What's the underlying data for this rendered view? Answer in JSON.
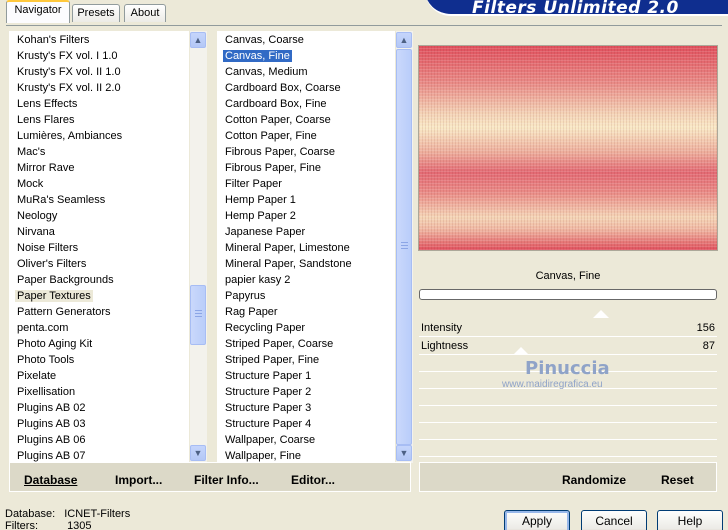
{
  "app": {
    "title": "Filters Unlimited 2.0"
  },
  "tabs": [
    {
      "label": "Navigator",
      "active": true
    },
    {
      "label": "Presets",
      "active": false
    },
    {
      "label": "About",
      "active": false
    }
  ],
  "categories": {
    "items": [
      "Kohan's Filters",
      "Krusty's FX vol. I 1.0",
      "Krusty's FX vol. II 1.0",
      "Krusty's FX vol. II 2.0",
      "Lens Effects",
      "Lens Flares",
      "Lumières, Ambiances",
      "Mac's",
      "Mirror Rave",
      "Mock",
      "MuRa's Seamless",
      "Neology",
      "Nirvana",
      "Noise Filters",
      "Oliver's Filters",
      "Paper Backgrounds",
      "Paper Textures",
      "Pattern Generators",
      "penta.com",
      "Photo Aging Kit",
      "Photo Tools",
      "Pixelate",
      "Pixellisation",
      "Plugins AB 02",
      "Plugins AB 03",
      "Plugins AB 06",
      "Plugins AB 07"
    ],
    "selected": "Paper Textures"
  },
  "filters": {
    "items": [
      "Canvas, Coarse",
      "Canvas, Fine",
      "Canvas, Medium",
      "Cardboard Box, Coarse",
      "Cardboard Box, Fine",
      "Cotton Paper, Coarse",
      "Cotton Paper, Fine",
      "Fibrous Paper, Coarse",
      "Fibrous Paper, Fine",
      "Filter Paper",
      "Hemp Paper 1",
      "Hemp Paper 2",
      "Japanese Paper",
      "Mineral Paper, Limestone",
      "Mineral Paper, Sandstone",
      "papier kasy 2",
      "Papyrus",
      "Rag Paper",
      "Recycling Paper",
      "Striped Paper, Coarse",
      "Striped Paper, Fine",
      "Structure Paper 1",
      "Structure Paper 2",
      "Structure Paper 3",
      "Structure Paper 4",
      "Wallpaper, Coarse",
      "Wallpaper, Fine"
    ],
    "selected": "Canvas, Fine"
  },
  "preview": {
    "filter_name": "Canvas, Fine"
  },
  "sliders": [
    {
      "label": "Intensity",
      "value": "156",
      "level": 0.612
    },
    {
      "label": "Lightness",
      "value": "87",
      "level": 0.341
    }
  ],
  "watermark": {
    "name": "Pinuccia",
    "site": "www.maidiregrafica.eu"
  },
  "toolbar_left": {
    "database": "Database",
    "import": "Import...",
    "filter_info": "Filter Info...",
    "editor": "Editor..."
  },
  "toolbar_right": {
    "randomize": "Randomize",
    "reset": "Reset"
  },
  "status": {
    "database_label": "Database:",
    "database_value": "ICNET-Filters",
    "filters_label": "Filters:",
    "filters_value": "1305"
  },
  "buttons": {
    "apply": "Apply",
    "cancel": "Cancel",
    "help": "Help"
  }
}
